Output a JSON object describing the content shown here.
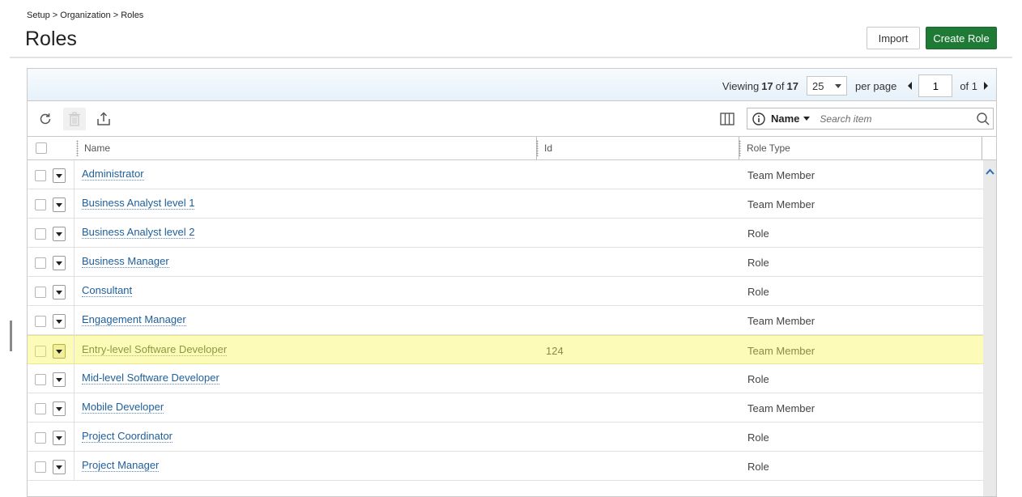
{
  "breadcrumb": "Setup > Organization > Roles",
  "page_title": "Roles",
  "buttons": {
    "import": "Import",
    "create": "Create Role"
  },
  "pager": {
    "viewing_label": "Viewing",
    "shown": "17",
    "of_word": "of",
    "total": "17",
    "per_page_value": "25",
    "per_page_label": "per page",
    "page_value": "1",
    "of_pages": "of 1"
  },
  "search": {
    "field": "Name",
    "placeholder": "Search item"
  },
  "columns": {
    "name": "Name",
    "id": "Id",
    "role_type": "Role Type"
  },
  "rows": [
    {
      "name": "Administrator",
      "id": "",
      "role_type": "Team Member"
    },
    {
      "name": "Business Analyst level 1",
      "id": "",
      "role_type": "Team Member"
    },
    {
      "name": "Business Analyst level 2",
      "id": "",
      "role_type": "Role"
    },
    {
      "name": "Business Manager",
      "id": "",
      "role_type": "Role"
    },
    {
      "name": "Consultant",
      "id": "",
      "role_type": "Role"
    },
    {
      "name": "Engagement Manager",
      "id": "",
      "role_type": "Team Member"
    },
    {
      "name": "Entry-level Software Developer",
      "id": "124",
      "role_type": "Team Member"
    },
    {
      "name": "Mid-level Software Developer",
      "id": "",
      "role_type": "Role"
    },
    {
      "name": "Mobile Developer",
      "id": "",
      "role_type": "Team Member"
    },
    {
      "name": "Project Coordinator",
      "id": "",
      "role_type": "Role"
    },
    {
      "name": "Project Manager",
      "id": "",
      "role_type": "Role"
    }
  ],
  "highlighted_row": 6,
  "colors": {
    "accent_green": "#1f7a36",
    "link_blue": "#1e5f9a",
    "highlight": "#fcfbb8"
  },
  "icons": [
    "refresh-icon",
    "delete-icon",
    "export-icon",
    "columns-icon",
    "info-icon",
    "search-icon",
    "chevron-up-icon"
  ]
}
